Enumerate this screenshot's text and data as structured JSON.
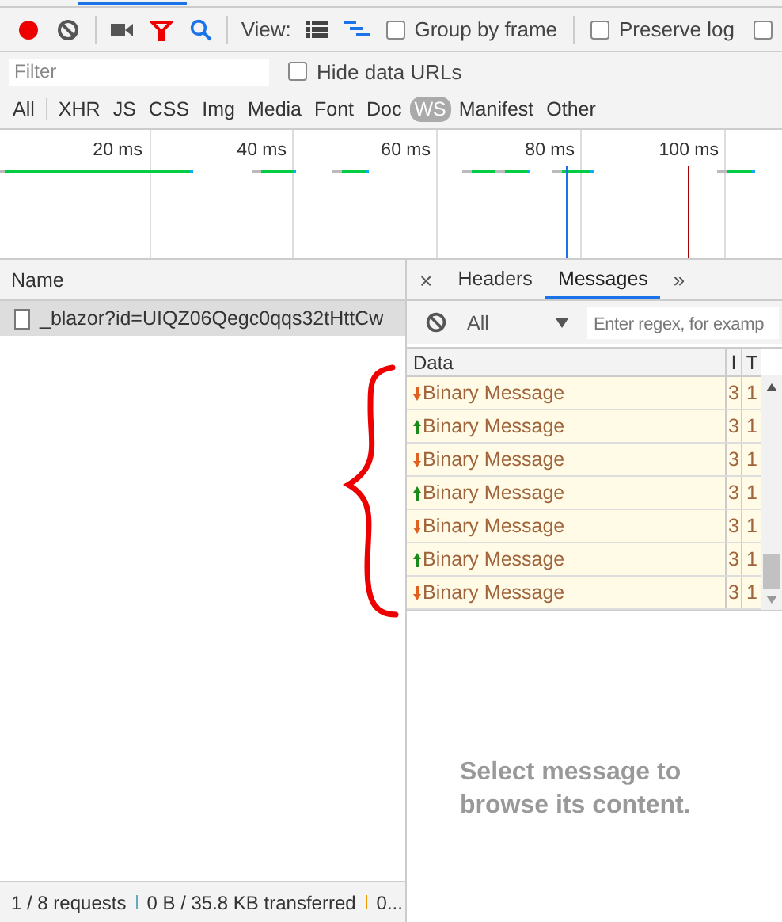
{
  "toolbar": {
    "view_label": "View:",
    "options": [
      {
        "label": "Group by frame",
        "checked": false
      },
      {
        "label": "Preserve log",
        "checked": false
      },
      {
        "checked": false
      }
    ]
  },
  "filter_bar": {
    "placeholder": "Filter",
    "hide_data_urls": {
      "label": "Hide data URLs",
      "checked": false
    }
  },
  "type_filters": [
    {
      "label": "All",
      "selected": false
    },
    {
      "label": "XHR",
      "selected": false
    },
    {
      "label": "JS",
      "selected": false
    },
    {
      "label": "CSS",
      "selected": false
    },
    {
      "label": "Img",
      "selected": false
    },
    {
      "label": "Media",
      "selected": false
    },
    {
      "label": "Font",
      "selected": false
    },
    {
      "label": "Doc",
      "selected": false
    },
    {
      "label": "WS",
      "selected": true
    },
    {
      "label": "Manifest",
      "selected": false
    },
    {
      "label": "Other",
      "selected": false
    }
  ],
  "overview": {
    "ticks": [
      "20 ms",
      "40 ms",
      "60 ms",
      "80 ms",
      "100 ms"
    ]
  },
  "requests": {
    "column": "Name",
    "rows": [
      {
        "name": "_blazor?id=UIQZ06Qegc0qqs32tHttCw",
        "selected": true
      }
    ]
  },
  "detail_close": "×",
  "detail_more": "»",
  "detail_tabs": [
    {
      "label": "Headers",
      "selected": false
    },
    {
      "label": "Messages",
      "selected": true
    }
  ],
  "messages": {
    "filter": "All",
    "placeholder": "Enter regex, for examp",
    "columns": [
      "Data",
      "l",
      "T"
    ],
    "rows": [
      {
        "kind": "received",
        "data": "Binary Message",
        "length": "3",
        "time": "1"
      },
      {
        "kind": "sent",
        "data": "Binary Message",
        "length": "3",
        "time": "1"
      },
      {
        "kind": "received",
        "data": "Binary Message",
        "length": "3",
        "time": "1"
      },
      {
        "kind": "sent",
        "data": "Binary Message",
        "length": "3",
        "time": "1"
      },
      {
        "kind": "received",
        "data": "Binary Message",
        "length": "3",
        "time": "1"
      },
      {
        "kind": "sent",
        "data": "Binary Message",
        "length": "3",
        "time": "1"
      },
      {
        "kind": "received",
        "data": "Binary Message",
        "length": "3",
        "time": "1"
      }
    ],
    "empty_text": "Select message to browse its content."
  },
  "status_bar": [
    "1 / 8 requests",
    "0 B / 35.8 KB transferred",
    "0..."
  ]
}
